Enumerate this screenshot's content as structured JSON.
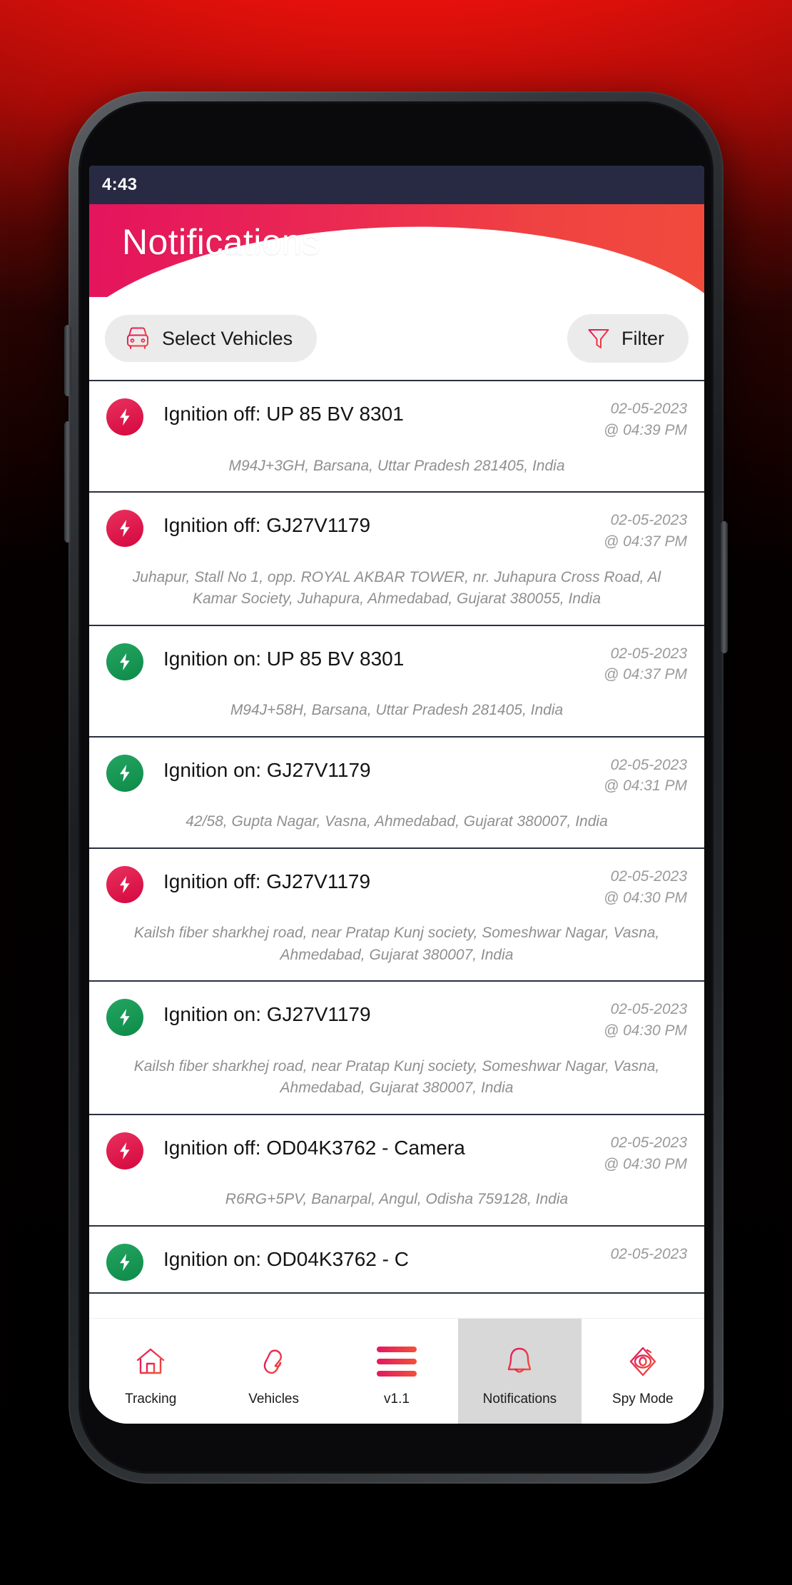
{
  "status_bar": {
    "time": "4:43"
  },
  "header": {
    "title": "Notifications"
  },
  "toolbar": {
    "select_vehicles": {
      "label": "Select Vehicles",
      "icon": "car-front-icon"
    },
    "filter": {
      "label": "Filter",
      "icon": "funnel-icon"
    }
  },
  "colors": {
    "accent_pink": "#e4145d",
    "accent_red": "#f14b3c",
    "status_bar": "#272a42",
    "badge_off": "#d5073f",
    "badge_on": "#0e8a49",
    "divider": "#2b3040",
    "pill_bg": "#ebebeb",
    "nav_active_bg": "#d8d8d8"
  },
  "notifications": [
    {
      "state": "off",
      "icon": "lightning-bolt-icon",
      "title": "Ignition off: UP 85 BV 8301",
      "date": "02-05-2023",
      "time": "@ 04:39 PM",
      "address": "M94J+3GH, Barsana, Uttar Pradesh 281405, India"
    },
    {
      "state": "off",
      "icon": "lightning-bolt-icon",
      "title": "Ignition off: GJ27V1179",
      "date": "02-05-2023",
      "time": "@ 04:37 PM",
      "address": "Juhapur, Stall No 1, opp. ROYAL AKBAR TOWER, nr. Juhapura Cross Road, Al Kamar Society, Juhapura, Ahmedabad, Gujarat 380055, India"
    },
    {
      "state": "on",
      "icon": "lightning-bolt-icon",
      "title": "Ignition on: UP 85 BV 8301",
      "date": "02-05-2023",
      "time": "@ 04:37 PM",
      "address": "M94J+58H, Barsana, Uttar Pradesh 281405, India"
    },
    {
      "state": "on",
      "icon": "lightning-bolt-icon",
      "title": "Ignition on: GJ27V1179",
      "date": "02-05-2023",
      "time": "@ 04:31 PM",
      "address": "42/58, Gupta Nagar, Vasna, Ahmedabad, Gujarat 380007, India"
    },
    {
      "state": "off",
      "icon": "lightning-bolt-icon",
      "title": "Ignition off: GJ27V1179",
      "date": "02-05-2023",
      "time": "@ 04:30 PM",
      "address": "Kailsh fiber sharkhej road, near Pratap Kunj society, Someshwar Nagar, Vasna, Ahmedabad, Gujarat 380007, India"
    },
    {
      "state": "on",
      "icon": "lightning-bolt-icon",
      "title": "Ignition on: GJ27V1179",
      "date": "02-05-2023",
      "time": "@ 04:30 PM",
      "address": "Kailsh fiber sharkhej road, near Pratap Kunj society, Someshwar Nagar, Vasna, Ahmedabad, Gujarat 380007, India"
    },
    {
      "state": "off",
      "icon": "lightning-bolt-icon",
      "title": "Ignition off: OD04K3762 - Camera",
      "date": "02-05-2023",
      "time": "@ 04:30 PM",
      "address": "R6RG+5PV, Banarpal, Angul, Odisha 759128, India"
    },
    {
      "state": "on",
      "icon": "lightning-bolt-icon",
      "title": "Ignition on: OD04K3762 - C",
      "date": "02-05-2023",
      "time": "",
      "address": ""
    }
  ],
  "bottom_nav": [
    {
      "label": "Tracking",
      "icon": "home-icon",
      "active": false
    },
    {
      "label": "Vehicles",
      "icon": "chain-link-icon",
      "active": false
    },
    {
      "label": "v1.1",
      "icon": "menu-bars-icon",
      "active": false
    },
    {
      "label": "Notifications",
      "icon": "bell-icon",
      "active": true
    },
    {
      "label": "Spy Mode",
      "icon": "eye-diamond-icon",
      "active": false
    }
  ]
}
